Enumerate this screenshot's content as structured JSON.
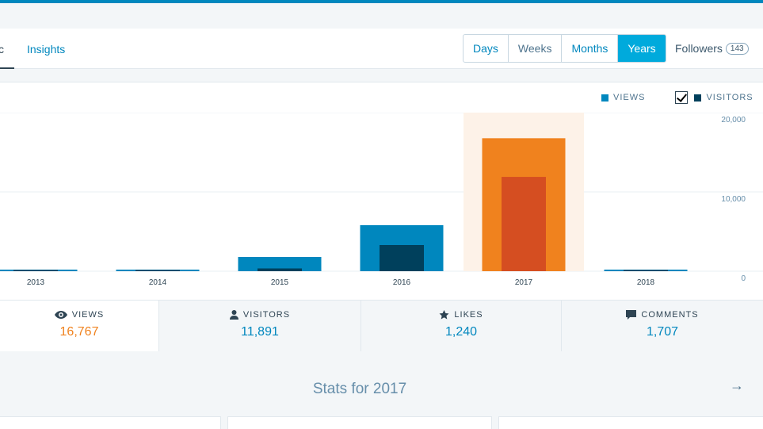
{
  "nav": {
    "tabs": [
      {
        "label": "c",
        "selected": true
      },
      {
        "label": "Insights",
        "selected": false
      }
    ],
    "periods": [
      "Days",
      "Weeks",
      "Months",
      "Years"
    ],
    "active_period": "Years",
    "followers_label": "Followers",
    "followers_count": "143"
  },
  "legend": {
    "views": "VIEWS",
    "visitors": "VISITORS"
  },
  "chart_data": {
    "type": "bar",
    "categories": [
      "2013",
      "2014",
      "2015",
      "2016",
      "2017",
      "2018"
    ],
    "series": [
      {
        "name": "VIEWS",
        "values": [
          150,
          150,
          1800,
          5800,
          16767,
          150
        ]
      },
      {
        "name": "VISITORS",
        "values": [
          100,
          100,
          350,
          3300,
          11891,
          100
        ]
      }
    ],
    "highlighted_category": "2017",
    "ylim": [
      0,
      20000
    ],
    "yticks": [
      "0",
      "10,000",
      "20,000"
    ],
    "colors": {
      "views": "#0087be",
      "visitors": "#00405c",
      "views_selected": "#f0821e",
      "visitors_selected": "#d54e21",
      "highlight_bg": "#fdf2e8"
    }
  },
  "summary": [
    {
      "label": "VIEWS",
      "value": "16,767",
      "icon": "eye-icon"
    },
    {
      "label": "VISITORS",
      "value": "11,891",
      "icon": "person-icon"
    },
    {
      "label": "LIKES",
      "value": "1,240",
      "icon": "star-icon"
    },
    {
      "label": "COMMENTS",
      "value": "1,707",
      "icon": "comment-icon"
    }
  ],
  "stats_title": "Stats for 2017"
}
